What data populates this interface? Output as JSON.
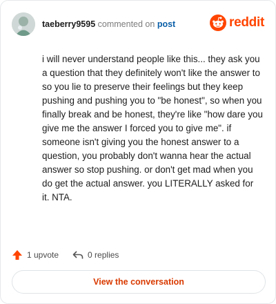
{
  "header": {
    "username": "taeberry9595",
    "action_text": "commented on",
    "post_link": "post",
    "logo_text": "reddit"
  },
  "comment": {
    "text": "i will never understand people like this... they ask you a question that they definitely won't like the answer to so you lie to preserve their feelings but they keep pushing and pushing you to \"be honest\", so when you finally break and be honest, they're like \"how dare you give me the answer I forced you to give me\". if someone isn't giving you the honest answer to a question, you probably don't wanna hear the actual answer so stop pushing. or don't get mad when you do get the actual answer. you LITERALLY asked for it. NTA."
  },
  "actions": {
    "upvotes": "1 upvote",
    "replies": "0 replies"
  },
  "view_button": "View the conversation",
  "colors": {
    "brand": "#ff4500",
    "link": "#0a5fa8",
    "button_text": "#d93a00"
  },
  "icons": [
    "avatar",
    "reddit-logo-icon",
    "upvote-arrow-icon",
    "reply-arrow-icon"
  ]
}
